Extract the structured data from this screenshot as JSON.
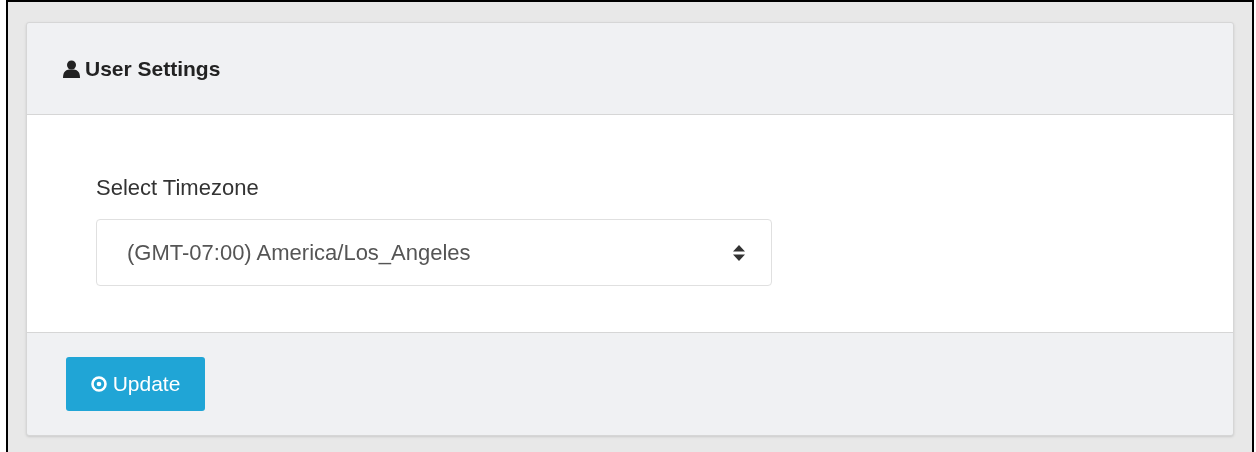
{
  "panel": {
    "title": "User Settings"
  },
  "timezone": {
    "label": "Select Timezone",
    "value": "(GMT-07:00) America/Los_Angeles"
  },
  "buttons": [
    {
      "label": "Update"
    }
  ]
}
